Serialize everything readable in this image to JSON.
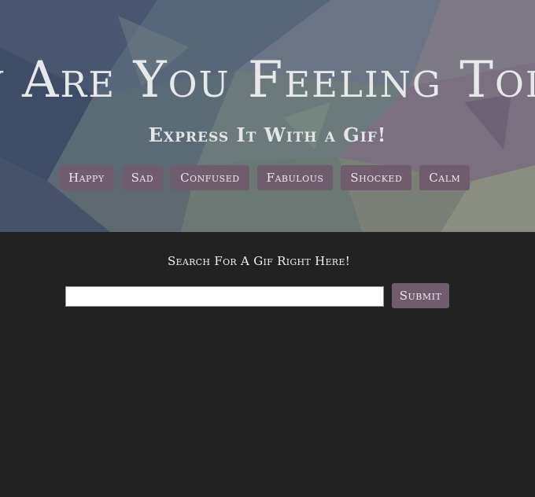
{
  "hero": {
    "title": "y Are You Feeling Tod",
    "subtitle": "Express It With a Gif!",
    "moods": [
      "Happy",
      "Sad",
      "Confused",
      "Fabulous",
      "Shocked",
      "Calm"
    ]
  },
  "search": {
    "label": "Search For A Gif Right Here!",
    "input_value": "",
    "submit_label": "Submit"
  },
  "colors": {
    "button_bg": "#6f5d6d",
    "page_bg": "#222222"
  }
}
